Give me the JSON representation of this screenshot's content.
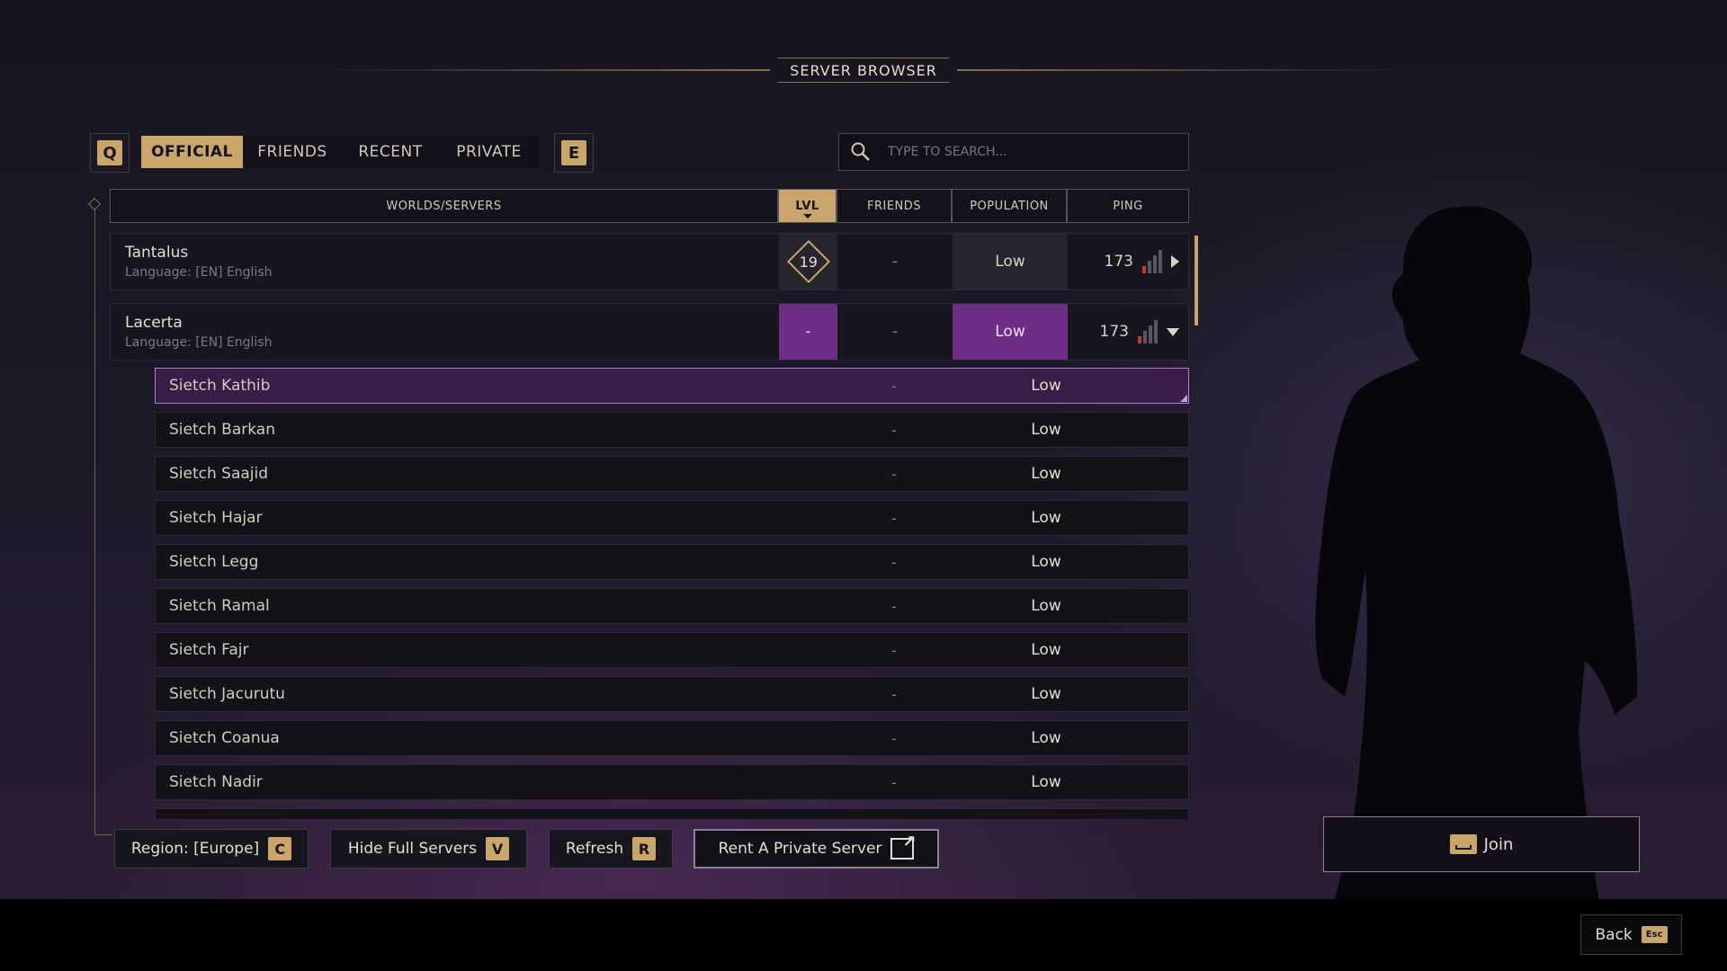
{
  "title": "SERVER BROWSER",
  "tabs": {
    "prev_key": "Q",
    "next_key": "E",
    "items": [
      "OFFICIAL",
      "FRIENDS",
      "RECENT",
      "PRIVATE"
    ],
    "active": "OFFICIAL"
  },
  "search": {
    "placeholder": "TYPE TO SEARCH...",
    "icon": "search-icon"
  },
  "columns": {
    "worlds": "WORLDS/SERVERS",
    "lvl": "LVL",
    "friends": "FRIENDS",
    "population": "POPULATION",
    "ping": "PING"
  },
  "worlds": [
    {
      "name": "Tantalus",
      "language": "Language: [EN] English",
      "lvl": "19",
      "friends": "-",
      "population": "Low",
      "ping": "173",
      "expanded": false
    },
    {
      "name": "Lacerta",
      "language": "Language: [EN] English",
      "lvl": "-",
      "friends": "-",
      "population": "Low",
      "ping": "173",
      "expanded": true
    }
  ],
  "servers": [
    {
      "name": "Sietch Kathib",
      "friends": "-",
      "population": "Low",
      "selected": true
    },
    {
      "name": "Sietch Barkan",
      "friends": "-",
      "population": "Low"
    },
    {
      "name": "Sietch Saajid",
      "friends": "-",
      "population": "Low"
    },
    {
      "name": "Sietch Hajar",
      "friends": "-",
      "population": "Low"
    },
    {
      "name": "Sietch Legg",
      "friends": "-",
      "population": "Low"
    },
    {
      "name": "Sietch Ramal",
      "friends": "-",
      "population": "Low"
    },
    {
      "name": "Sietch Fajr",
      "friends": "-",
      "population": "Low"
    },
    {
      "name": "Sietch Jacurutu",
      "friends": "-",
      "population": "Low"
    },
    {
      "name": "Sietch Coanua",
      "friends": "-",
      "population": "Low"
    },
    {
      "name": "Sietch Nadir",
      "friends": "-",
      "population": "Low"
    }
  ],
  "buttons": {
    "region": {
      "label": "Region: [Europe]",
      "key": "C"
    },
    "hide_full": {
      "label": "Hide Full Servers",
      "key": "V"
    },
    "refresh": {
      "label": "Refresh",
      "key": "R"
    },
    "rent": {
      "label": "Rent A Private Server",
      "icon": "external-link-icon"
    },
    "join": {
      "label": "Join",
      "icon": "spacebar-icon"
    },
    "back": {
      "label": "Back",
      "key": "Esc"
    }
  },
  "colors": {
    "accent": "#c9a56a",
    "highlight": "#6d2d84",
    "selected_border": "#b07fd0"
  }
}
